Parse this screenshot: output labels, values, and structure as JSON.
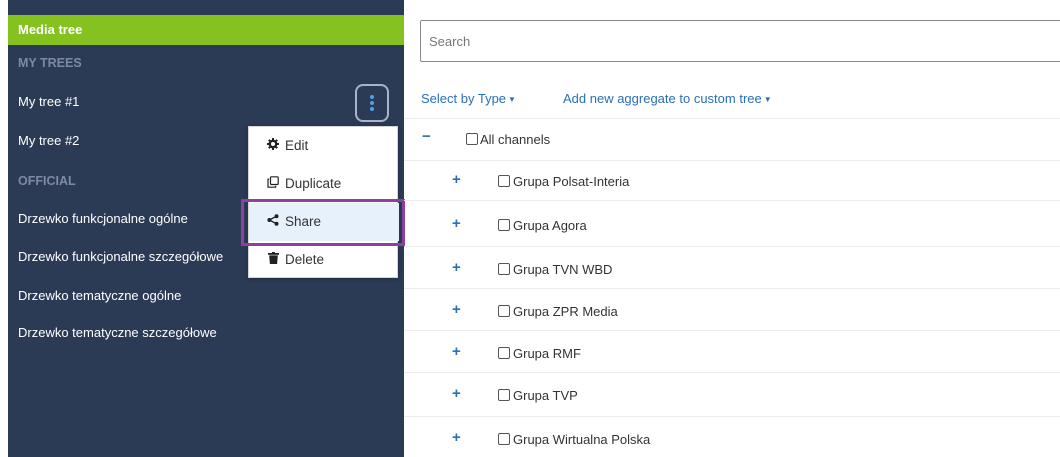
{
  "sidebar": {
    "header": "Media tree",
    "sections": {
      "my_trees": "MY TREES",
      "official": "OFFICIAL"
    },
    "my_trees": [
      "My tree #1",
      "My tree #2"
    ],
    "official": [
      "Drzewko funkcjonalne ogólne",
      "Drzewko funkcjonalne szczegółowe",
      "Drzewko tematyczne ogólne",
      "Drzewko tematyczne szczegółowe"
    ]
  },
  "context_menu": {
    "edit": "Edit",
    "duplicate": "Duplicate",
    "share": "Share",
    "delete": "Delete"
  },
  "main": {
    "search_placeholder": "Search",
    "select_by_type": "Select by Type",
    "add_aggregate": "Add new aggregate to custom tree",
    "all_channels": "All channels",
    "groups": [
      "Grupa Polsat-Interia",
      "Grupa Agora",
      "Grupa TVN WBD",
      "Grupa ZPR Media",
      "Grupa RMF",
      "Grupa TVP",
      "Grupa Wirtualna Polska"
    ]
  },
  "colors": {
    "sidebar_bg": "#2b3a55",
    "header_green": "#85c21f",
    "link_blue": "#2a6fb7",
    "highlight_purple": "#8e3fa0"
  }
}
